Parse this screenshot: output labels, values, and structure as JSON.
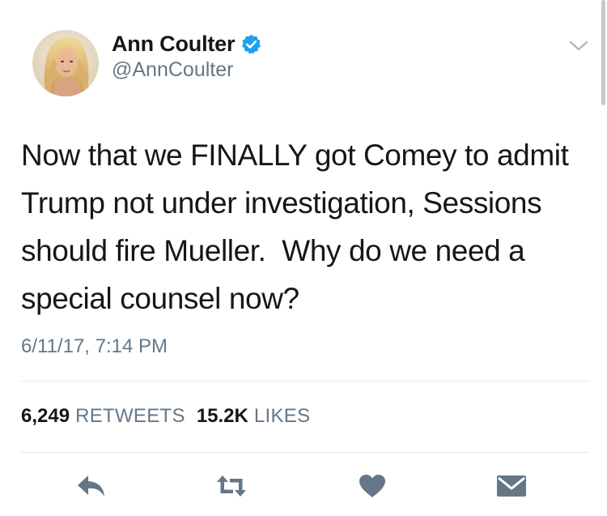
{
  "author": {
    "display_name": "Ann Coulter",
    "handle": "@AnnCoulter",
    "verified": true,
    "verified_badge_color": "#1da1f2"
  },
  "tweet": {
    "text": "Now that we FINALLY got Comey to admit Trump not under investigation, Sessions should fire Mueller.  Why do we need a special counsel now?",
    "timestamp": "6/11/17, 7:14 PM"
  },
  "stats": {
    "retweets_count": "6,249",
    "retweets_label": "RETWEETS",
    "likes_count": "15.2K",
    "likes_label": "LIKES"
  },
  "actions": [
    {
      "name": "reply",
      "icon": "reply-icon"
    },
    {
      "name": "retweet",
      "icon": "retweet-icon"
    },
    {
      "name": "like",
      "icon": "heart-icon"
    },
    {
      "name": "direct-message",
      "icon": "envelope-icon"
    }
  ],
  "colors": {
    "text_primary": "#14171a",
    "text_secondary": "#657786",
    "icon": "#657786",
    "divider": "#e1e8ed"
  }
}
